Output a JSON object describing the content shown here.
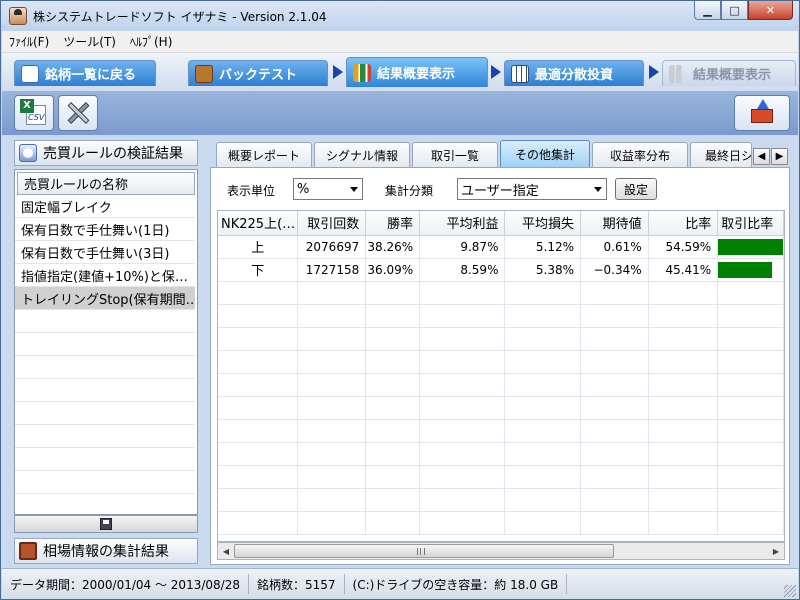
{
  "window": {
    "title": "株システムトレードソフト イザナミ - Version 2.1.04",
    "min_glyph": "▁",
    "max_glyph": "□",
    "close_glyph": "✕"
  },
  "menu": [
    "ﾌｧｲﾙ(F)",
    "ツール(T)",
    "ﾍﾙﾌﾟ(H)"
  ],
  "nav_tabs": [
    {
      "label": "銘柄一覧に戻る",
      "state": "normal"
    },
    {
      "label": "バックテスト",
      "state": "normal"
    },
    {
      "label": "結果概要表示",
      "state": "active"
    },
    {
      "label": "最適分散投資",
      "state": "normal"
    },
    {
      "label": "結果概要表示",
      "state": "disabled"
    }
  ],
  "toolbar": {
    "csv_badge": "X",
    "csv_label": "CSV"
  },
  "left_panel": {
    "title": "売買ルールの検証結果",
    "list_header": "売買ルールの名称",
    "rules": [
      "固定幅ブレイク",
      "保有日数で手仕舞い(1日)",
      "保有日数で手仕舞い(3日)",
      "指値指定(建値+10%)と保…",
      "トレイリングStop(保有期間…"
    ],
    "selected_index": 4,
    "market_title": "相場情報の集計結果"
  },
  "sub_tabs": [
    "概要レポート",
    "シグナル情報",
    "取引一覧",
    "その他集計",
    "収益率分布",
    "最終日シ"
  ],
  "active_sub_tab": 3,
  "tab_scroll": {
    "left": "◀",
    "right": "▶"
  },
  "controls": {
    "unit_label": "表示単位",
    "unit_value": "%",
    "group_label": "集計分類",
    "group_value": "ユーザー指定",
    "set_button": "設定"
  },
  "grid": {
    "headers": [
      "NK225上(…",
      "取引回数",
      "勝率",
      "平均利益",
      "平均損失",
      "期待値",
      "比率",
      "取引比率"
    ],
    "rows": [
      {
        "cat": "上",
        "count": "2076697",
        "win": "38.26%",
        "avg_profit": "9.87%",
        "avg_loss": "5.12%",
        "expect": "0.61%",
        "ratio": "54.59%",
        "bar": 0.5459
      },
      {
        "cat": "下",
        "count": "1727158",
        "win": "36.09%",
        "avg_profit": "8.59%",
        "avg_loss": "5.38%",
        "expect": "−0.34%",
        "ratio": "45.41%",
        "bar": 0.4541
      }
    ],
    "bar_color": "#008000",
    "scroll_left": "◀",
    "scroll_right": "▶"
  },
  "status": {
    "period": "データ期間：2000/01/04 ～ 2013/08/28",
    "stocks": "銘柄数：5157",
    "disk": "(C:)ドライブの空き容量：約 18.0 GB"
  }
}
